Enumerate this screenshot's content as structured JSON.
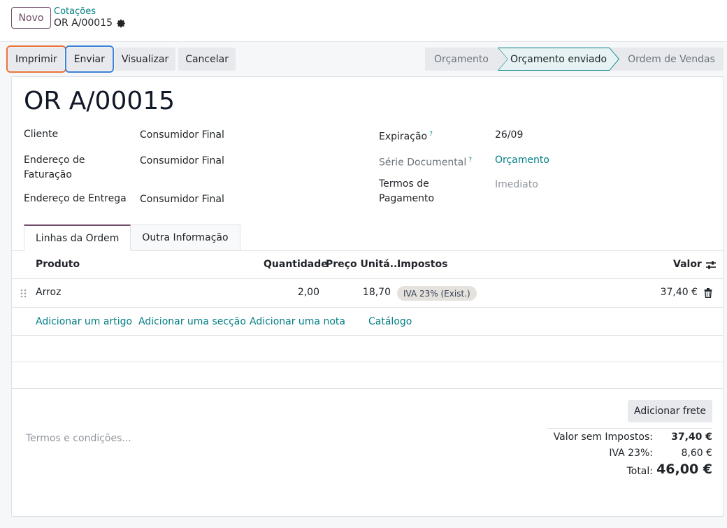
{
  "header": {
    "new_button": "Novo",
    "breadcrumb": "Cotações",
    "record_name": "OR A/00015"
  },
  "actions": {
    "print": "Imprimir",
    "send": "Enviar",
    "preview": "Visualizar",
    "cancel": "Cancelar"
  },
  "status": {
    "stages": [
      "Orçamento",
      "Orçamento enviado",
      "Ordem de Vendas"
    ],
    "active_index": 1
  },
  "form": {
    "title": "OR A/00015",
    "customer_label": "Cliente",
    "customer_value": "Consumidor Final",
    "invoice_addr_label_1": "Endereço de",
    "invoice_addr_label_2": "Faturação",
    "invoice_addr_value": "Consumidor Final",
    "delivery_addr_label": "Endereço de Entrega",
    "delivery_addr_value": "Consumidor Final",
    "expiration_label": "Expiração",
    "expiration_value": "26/09",
    "series_label": "Série Documental",
    "series_value": "Orçamento",
    "payment_terms_label_1": "Termos de",
    "payment_terms_label_2": "Pagamento",
    "payment_terms_placeholder": "Imediato",
    "help_mark": "?"
  },
  "tabs": [
    "Linhas da Ordem",
    "Outra Informação"
  ],
  "table": {
    "headers": {
      "product": "Produto",
      "quantity": "Quantidade",
      "unit_price": "Preço Unitá...",
      "taxes": "Impostos",
      "amount": "Valor"
    },
    "rows": [
      {
        "product": "Arroz",
        "quantity": "2,00",
        "unit_price": "18,70",
        "tax": "IVA 23% (Exist.)",
        "amount": "37,40 €"
      }
    ],
    "add_links": {
      "item": "Adicionar um artigo",
      "section": "Adicionar uma secção",
      "note": "Adicionar uma nota",
      "catalog": "Catálogo"
    }
  },
  "footer": {
    "terms_placeholder": "Termos e condições...",
    "add_shipping": "Adicionar frete",
    "untaxed_label": "Valor sem Impostos:",
    "untaxed_value": "37,40 €",
    "tax_label": "IVA 23%:",
    "tax_value": "8,60 €",
    "total_label": "Total:",
    "total_value": "46,00 €"
  },
  "colors": {
    "brand": "#714b67",
    "link": "#017e84",
    "highlight_orange": "#e8723a",
    "highlight_blue": "#3b82d6"
  },
  "icons": [
    "gear-icon",
    "drag-handle-icon",
    "trash-icon",
    "column-settings-icon"
  ]
}
